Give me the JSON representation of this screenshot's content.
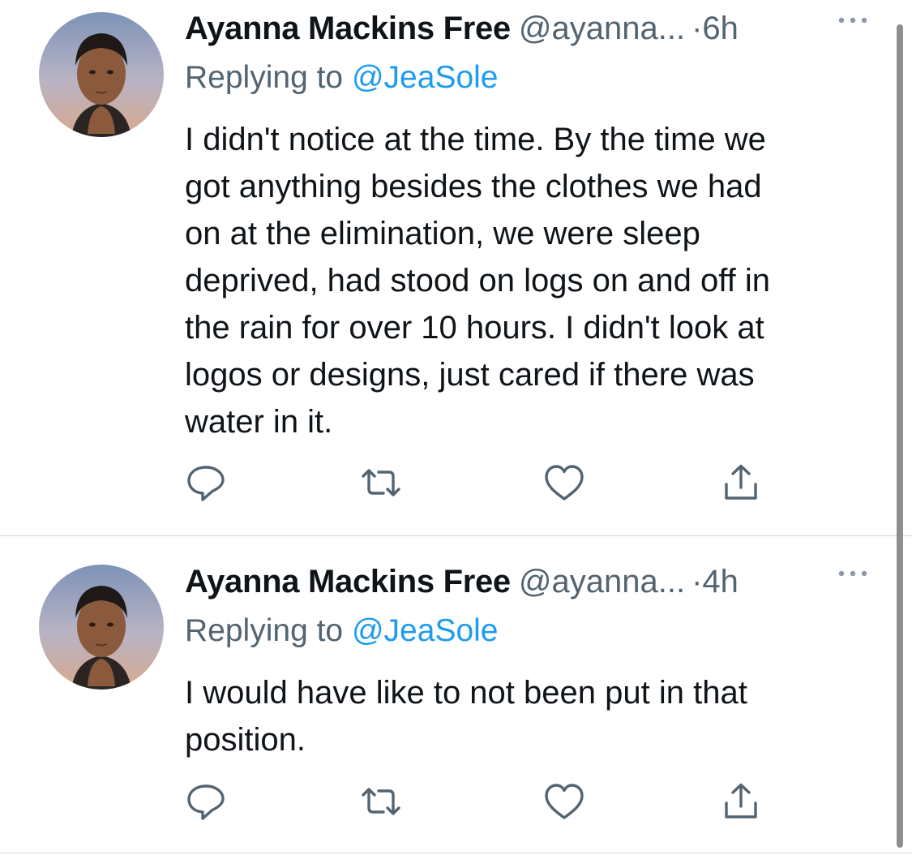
{
  "tweets": [
    {
      "display_name": "Ayanna Mackins Free",
      "handle": "@ayanna...",
      "separator": "·",
      "time": "6h",
      "replying_prefix": "Replying to",
      "replying_to": "@JeaSole",
      "body_lines": [
        "I didn't notice at the time.  By the time we",
        "got anything besides the clothes we had",
        "on at the elimination, we were sleep",
        "deprived, had stood on logs on and off in",
        "the rain for over 10 hours.  I didn't look at",
        "logos or designs, just cared if there was",
        "water in it."
      ]
    },
    {
      "display_name": "Ayanna Mackins Free",
      "handle": "@ayanna...",
      "separator": "·",
      "time": "4h",
      "replying_prefix": "Replying to",
      "replying_to": "@JeaSole",
      "body_lines": [
        "I would have like to not been put in that",
        "position."
      ]
    }
  ],
  "actions": {
    "reply_icon": "reply-icon",
    "retweet_icon": "retweet-icon",
    "like_icon": "like-icon",
    "share_icon": "share-icon",
    "more_icon": "more-icon"
  },
  "colors": {
    "text": "#0f1419",
    "secondary": "#536471",
    "link": "#1d9bf0",
    "divider": "#cfd9de",
    "scrollbar": "#8e8e8e"
  }
}
